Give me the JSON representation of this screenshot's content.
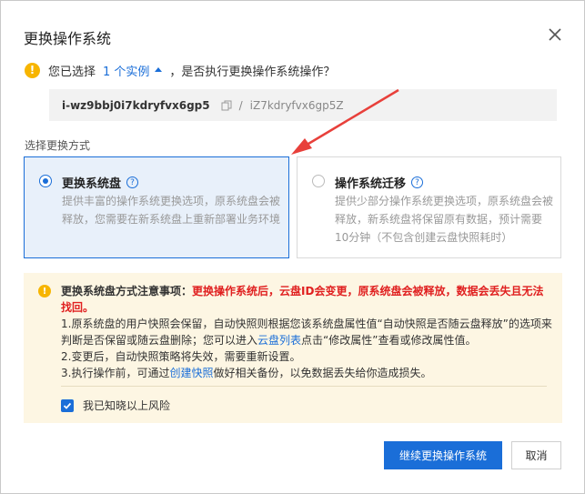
{
  "dialog": {
    "title": "更换操作系统"
  },
  "question": {
    "prefix": "您已选择",
    "instance_link": "1 个实例",
    "suffix": "，是否执行更换操作系统操作？"
  },
  "instance": {
    "id": "i-wz9bbj0i7kdryfvx6gp5",
    "separator": "/",
    "disk_id": "iZ7kdryfvx6gp5Z"
  },
  "method": {
    "label": "选择更换方式",
    "options": [
      {
        "title": "更换系统盘",
        "description": "提供丰富的操作系统更换选项，原系统盘会被释放，您需要在新系统盘上重新部署业务环境",
        "selected": true
      },
      {
        "title": "操作系统迁移",
        "description": "提供少部分操作系统更换选项，原系统盘会被释放，新系统盘将保留原有数据，预计需要10分钟（不包含创建云盘快照耗时）",
        "selected": false
      }
    ]
  },
  "notice": {
    "title": "更换系统盘方式注意事项：",
    "warning": "更换操作系统后，云盘ID会变更，原系统盘会被释放，数据会丢失且无法找回。",
    "line1_a": "1.原系统盘的用户快照会保留，自动快照则根据您该系统盘属性值“自动快照是否随云盘释放”的选项来判断是否保留或随云盘删除；您可以进入",
    "line1_link": "云盘列表",
    "line1_b": "点击“修改属性”查看或修改属性值。",
    "line2": "2.变更后，自动快照策略将失效，需要重新设置。",
    "line3_a": "3.执行操作前，可通过",
    "line3_link": "创建快照",
    "line3_b": "做好相关备份，以免数据丢失给你造成损失。",
    "ack_label": "我已知晓以上风险",
    "ack_checked": true
  },
  "buttons": {
    "continue": "继续更换操作系统",
    "cancel": "取消"
  },
  "colors": {
    "accent": "#1a6ed8",
    "warning_dot": "#f7b500",
    "danger": "#e02020",
    "annotation_arrow": "#e8403b"
  }
}
